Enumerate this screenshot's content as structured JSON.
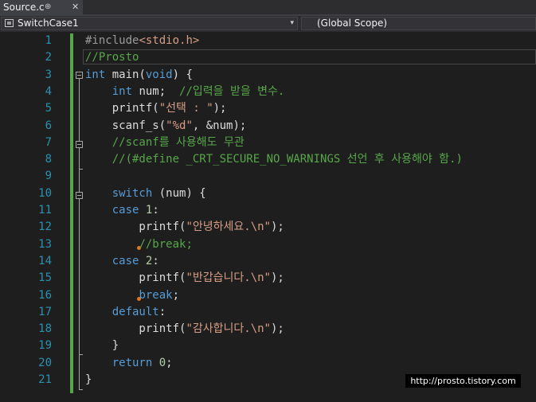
{
  "tab": {
    "title": "Source.c",
    "pin": "⊕",
    "close": "✕"
  },
  "nav": {
    "project": "SwitchCase1",
    "dropdown": "▾",
    "scope": "(Global Scope)"
  },
  "lines": [
    {
      "n": "1",
      "html": "<span class=\"pp\">#include</span><span class=\"str\">&lt;stdio.h&gt;</span>"
    },
    {
      "n": "2",
      "html": "<span class=\"cm\">//Prosto</span>"
    },
    {
      "n": "3",
      "html": "<span class=\"kw\">int</span> main(<span class=\"kw\">void</span>) {"
    },
    {
      "n": "4",
      "html": "    <span class=\"kw\">int</span> num;  <span class=\"cm\">//입력을 받을 변수.</span>"
    },
    {
      "n": "5",
      "html": "    printf(<span class=\"str\">\"선택 : \"</span>);"
    },
    {
      "n": "6",
      "html": "    scanf_s(<span class=\"str\">\"%d\"</span>, &amp;num);"
    },
    {
      "n": "7",
      "html": "    <span class=\"cm\">//scanf를 사용해도 무관</span>"
    },
    {
      "n": "8",
      "html": "    <span class=\"cm\">//(#define _CRT_SECURE_NO_WARNINGS 선언 후 사용해야 함.)</span>"
    },
    {
      "n": "9",
      "html": ""
    },
    {
      "n": "10",
      "html": "    <span class=\"kw\">switch</span> (num) {"
    },
    {
      "n": "11",
      "html": "    <span class=\"kw\">case</span> <span class=\"num\">1</span>:"
    },
    {
      "n": "12",
      "html": "        printf(<span class=\"str\">\"안녕하세요.\\n\"</span>);"
    },
    {
      "n": "13",
      "html": "        <span class=\"cm\">//break;</span>"
    },
    {
      "n": "14",
      "html": "    <span class=\"kw\">case</span> <span class=\"num\">2</span>:"
    },
    {
      "n": "15",
      "html": "        printf(<span class=\"str\">\"반갑습니다.\\n\"</span>);"
    },
    {
      "n": "16",
      "html": "        <span class=\"kw\">break</span>;"
    },
    {
      "n": "17",
      "html": "    <span class=\"kw\">default</span>:"
    },
    {
      "n": "18",
      "html": "        printf(<span class=\"str\">\"감사합니다.\\n\"</span>);"
    },
    {
      "n": "19",
      "html": "    }"
    },
    {
      "n": "20",
      "html": "    <span class=\"kw\">return</span> <span class=\"num\">0</span>;"
    },
    {
      "n": "21",
      "html": "}"
    }
  ],
  "watermark": "http://prosto.tistory.com",
  "colors": {
    "background": "#1e1e1e",
    "keyword": "#569cd6",
    "string": "#d69d85",
    "comment": "#57a64a",
    "line_number": "#2b91af",
    "breakpoint_dot": "#e8741d"
  }
}
